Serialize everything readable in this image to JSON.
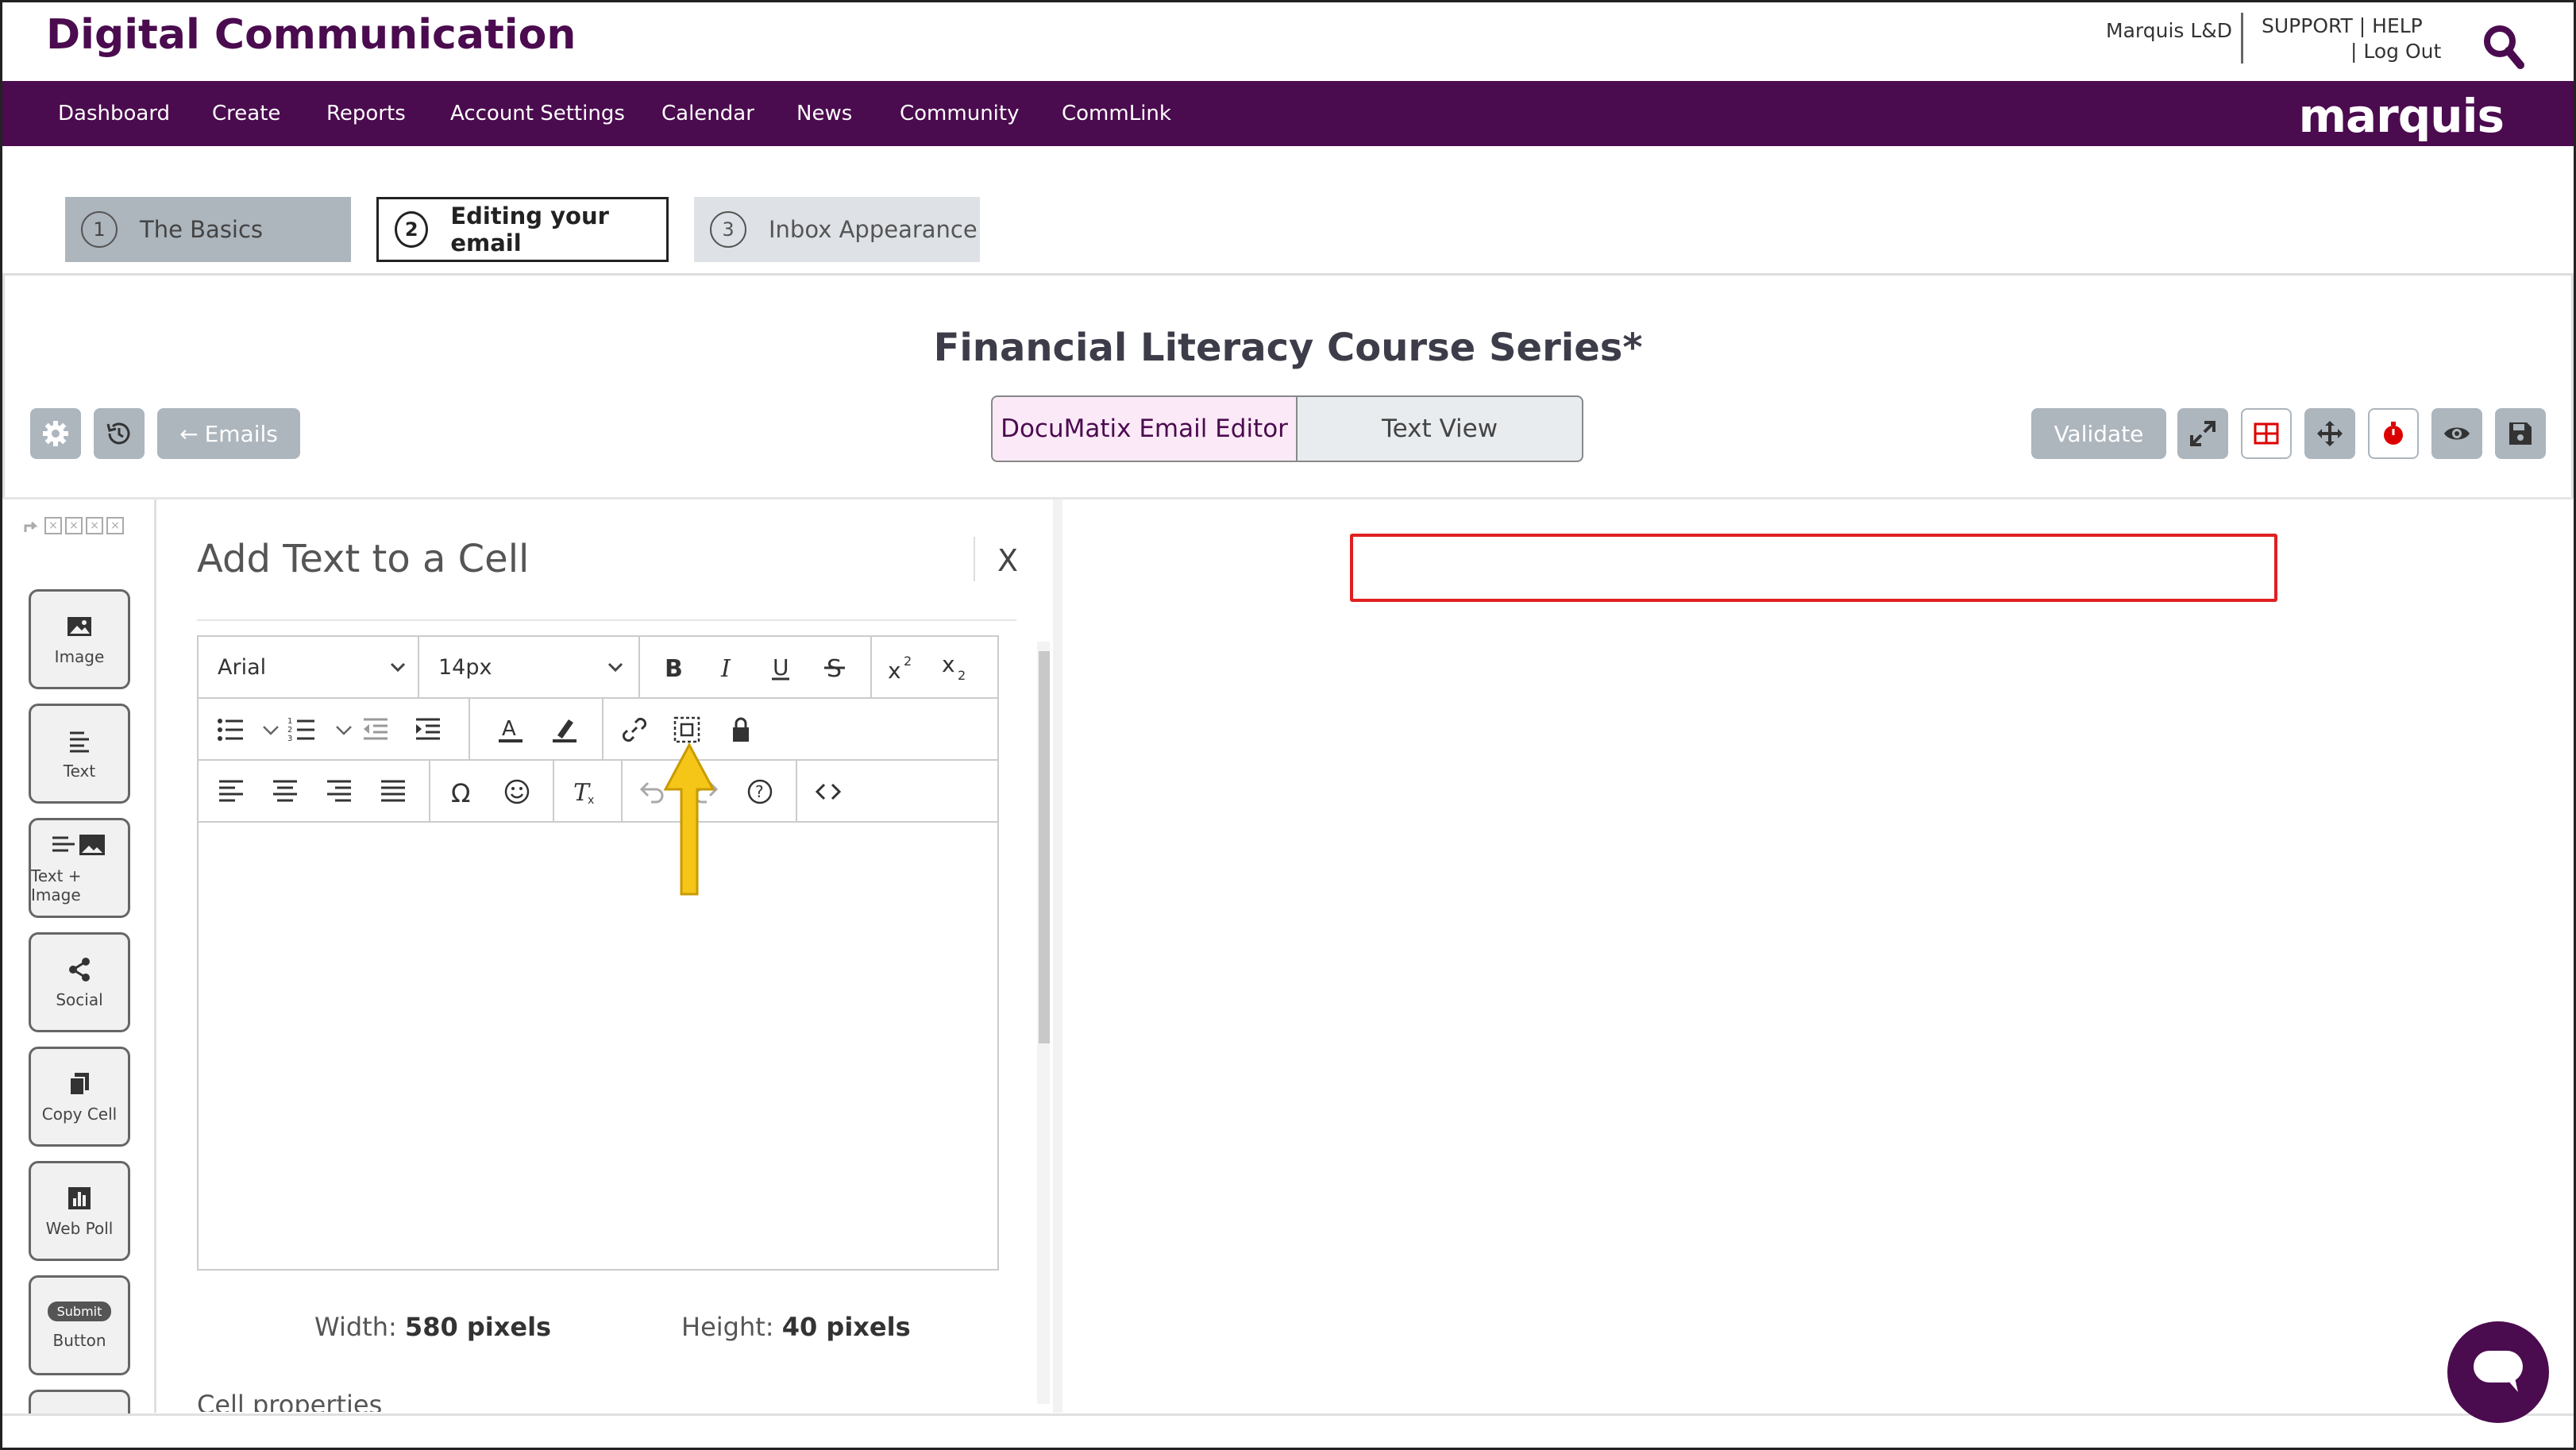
{
  "header": {
    "app_title": "Digital Communication",
    "user": "Marquis L&D",
    "support": "SUPPORT",
    "help": "HELP",
    "logout": "Log Out",
    "search_icon": "search-icon"
  },
  "nav": {
    "items": [
      "Dashboard",
      "Create",
      "Reports",
      "Account Settings",
      "Calendar",
      "News",
      "Community",
      "CommLink"
    ],
    "logo": "marquis"
  },
  "steps": [
    {
      "num": "1",
      "label": "The Basics"
    },
    {
      "num": "2",
      "label": "Editing your email"
    },
    {
      "num": "3",
      "label": "Inbox Appearance"
    }
  ],
  "editor": {
    "title": "Financial Literacy Course Series*",
    "emails_button": "Emails",
    "view_tabs": [
      "DocuMatix Email Editor",
      "Text View"
    ],
    "validate_button": "Validate"
  },
  "sidebar": {
    "tools": [
      "Image",
      "Text",
      "Text + Image",
      "Social",
      "Copy Cell",
      "Web Poll",
      "Button"
    ],
    "button_pill": "Submit"
  },
  "panel": {
    "title": "Add Text to a Cell",
    "close": "X",
    "font": "Arial",
    "size": "14px",
    "width_label": "Width:",
    "width_value": "580 pixels",
    "height_label": "Height:",
    "height_value": "40 pixels",
    "cell_properties": "Cell properties"
  },
  "colors": {
    "brand": "#4b0b4f",
    "highlight_border": "#e02020",
    "arrow": "#f5c518"
  }
}
